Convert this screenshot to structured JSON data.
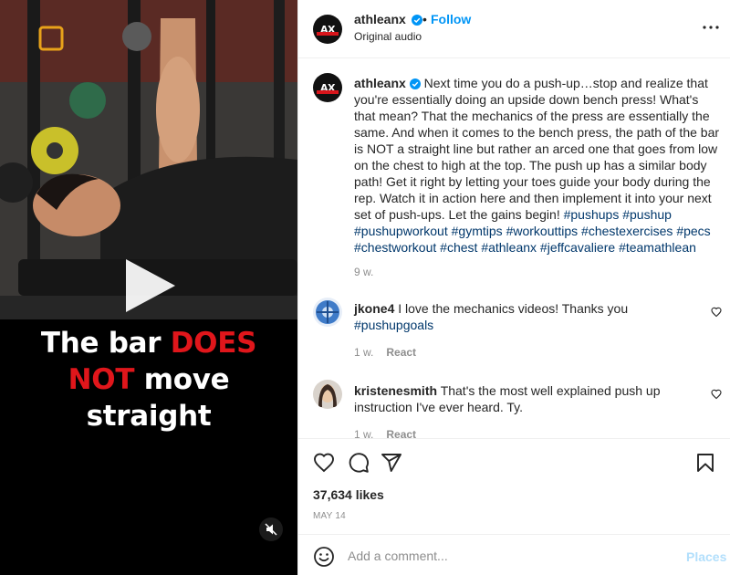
{
  "post": {
    "username": "athleanx",
    "avatar_initials": "AX",
    "follow_label": "Follow",
    "separator": "•",
    "audio_label": "Original audio",
    "caption": {
      "username": "athleanx",
      "text": "Next time you do a push-up…stop and realize that you're essentially doing an upside down bench press! What's that mean? That the mechanics of the press are essentially the same. And when it comes to the bench press, the path of the bar is NOT a straight line but rather an arced one that goes from low on the chest to high at the top. The push up has a similar body path! Get it right by letting your toes guide your body during the rep. Watch it in action here and then implement it into your next set of push-ups. Let the gains begin!",
      "hashtags": [
        "#pushups",
        "#pushup",
        "#pushupworkout",
        "#gymtips",
        "#workouttips",
        "#chestexercises",
        "#pecs",
        "#chestworkout",
        "#chest",
        "#athleanx",
        "#jeffcavaliere",
        "#teamathlean"
      ],
      "time": "9 w."
    },
    "comments": [
      {
        "username": "jkone4",
        "text": "I love the mechanics videos! Thanks you",
        "hashtag": "#pushupgoals",
        "time": "1 w.",
        "react_label": "React"
      },
      {
        "username": "kristenesmith",
        "text": "That's the most well explained push up instruction I've ever heard. Ty.",
        "time": "1 w.",
        "react_label": "React"
      }
    ],
    "likes": "37,634 likes",
    "date": "MAY 14",
    "comment_placeholder": "Add a comment...",
    "post_label": "Places"
  },
  "media": {
    "caption_parts": [
      {
        "text": "The bar ",
        "red": false
      },
      {
        "text": "DOES",
        "red": true
      },
      {
        "text": "NOT",
        "red": true
      },
      {
        "text": " move",
        "red": false
      },
      {
        "text": "straight",
        "red": false
      }
    ],
    "accent_color": "#e0161b"
  },
  "icons": [
    "heart-icon",
    "comment-icon",
    "share-icon",
    "save-icon",
    "more-icon",
    "verified-icon",
    "play-icon",
    "mute-icon",
    "emoji-icon"
  ],
  "colors": {
    "link": "#0095f6",
    "hashtag": "#00376b",
    "muted": "#8e8e8e",
    "post_disabled": "#b2dffc"
  }
}
